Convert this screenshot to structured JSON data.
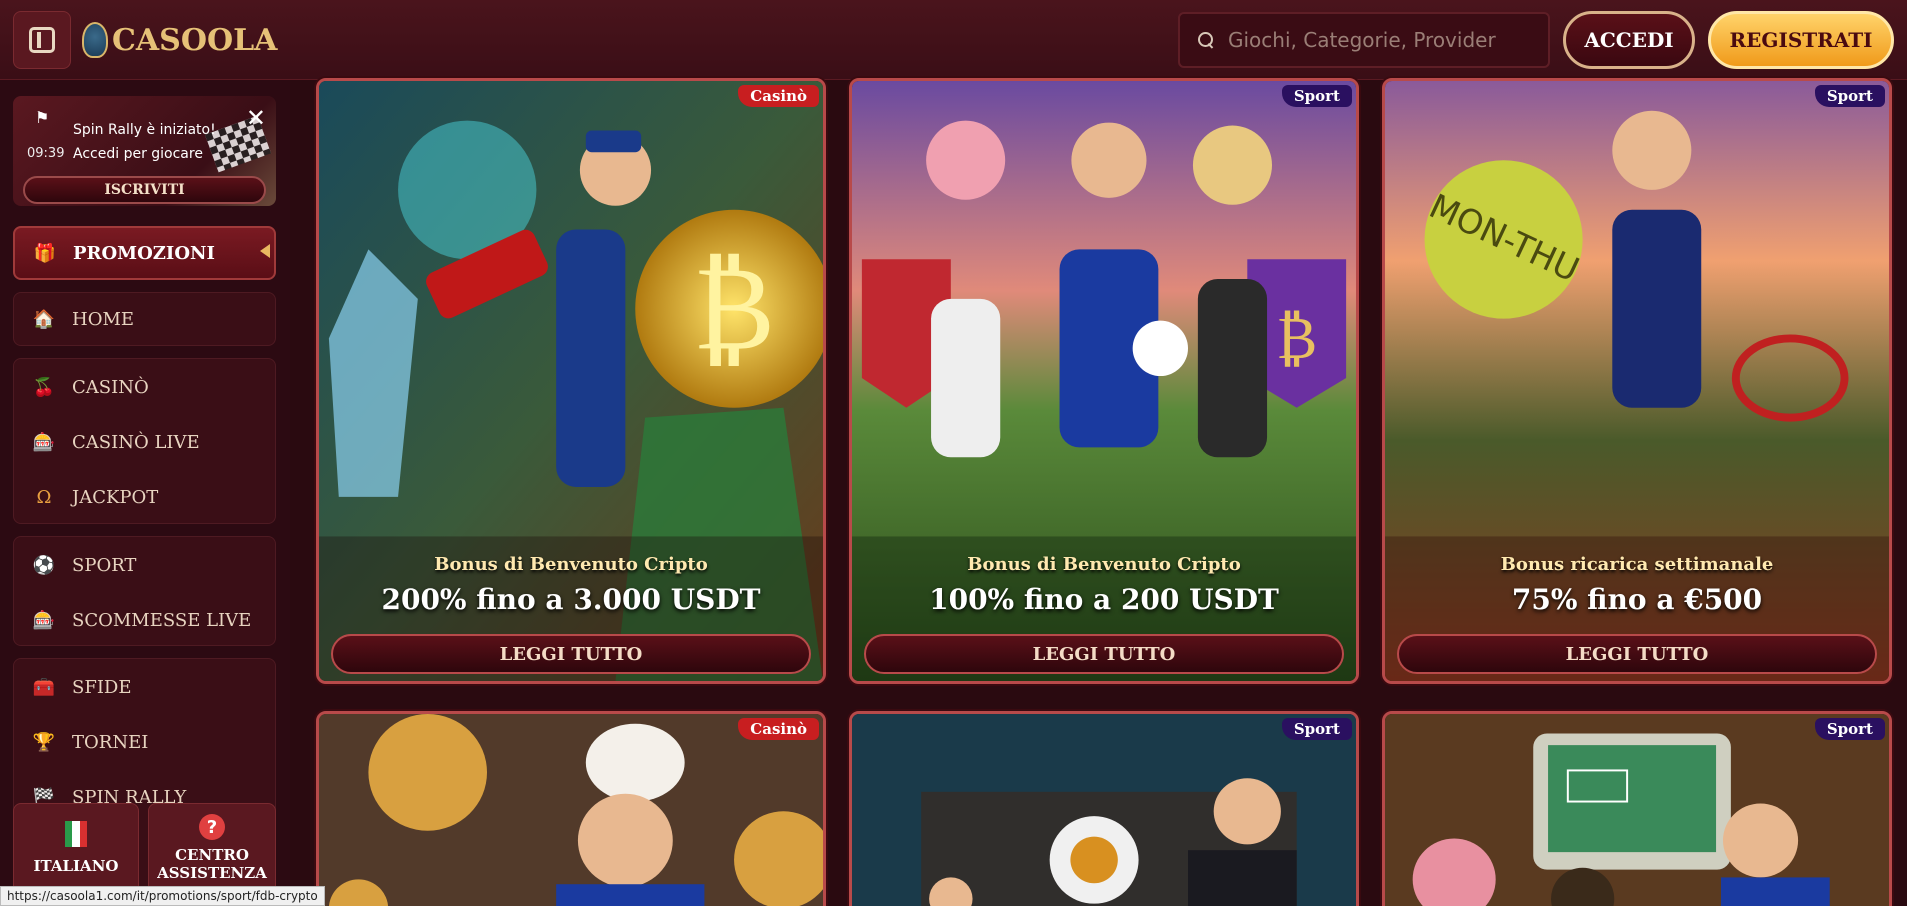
{
  "header": {
    "logo_text": "CASOOLA",
    "search_placeholder": "Giochi, Categorie, Provider",
    "login_label": "ACCEDI",
    "register_label": "REGISTRATI"
  },
  "rally": {
    "title": "Spin Rally è iniziato!",
    "subtitle": "Accedi per giocare",
    "time": "09:39",
    "close": "✕",
    "button": "ISCRIVITI"
  },
  "sidebar": {
    "promo": "PROMOZIONI",
    "home": "HOME",
    "casino": "CASINÒ",
    "casino_live": "CASINÒ LIVE",
    "jackpot": "JACKPOT",
    "sport": "SPORT",
    "scommesse_live": "SCOMMESSE LIVE",
    "sfide": "SFIDE",
    "tornei": "TORNEI",
    "spin_rally": "SPIN RALLY",
    "language": "ITALIANO",
    "help": "CENTRO ASSISTENZA"
  },
  "cards": [
    {
      "badge": "Casinò",
      "subtitle": "Bonus di Benvenuto Cripto",
      "title": "200% fino a 3.000 USDT",
      "button": "LEGGI TUTTO"
    },
    {
      "badge": "Sport",
      "subtitle": "Bonus di Benvenuto Cripto",
      "title": "100% fino a 200 USDT",
      "button": "LEGGI TUTTO"
    },
    {
      "badge": "Sport",
      "subtitle": "Bonus ricarica settimanale",
      "title": "75% fino a €500",
      "button": "LEGGI TUTTO"
    },
    {
      "badge": "Casinò"
    },
    {
      "badge": "Sport"
    },
    {
      "badge": "Sport"
    }
  ],
  "status_url": "https://casoola1.com/it/promotions/sport/fdb-crypto",
  "colors": {
    "background": "#2a0a10",
    "accent_gold": "#e6c177",
    "register_yellow": "#ffd36a",
    "casino_badge": "#c81e20",
    "sport_badge": "#2a1060"
  }
}
